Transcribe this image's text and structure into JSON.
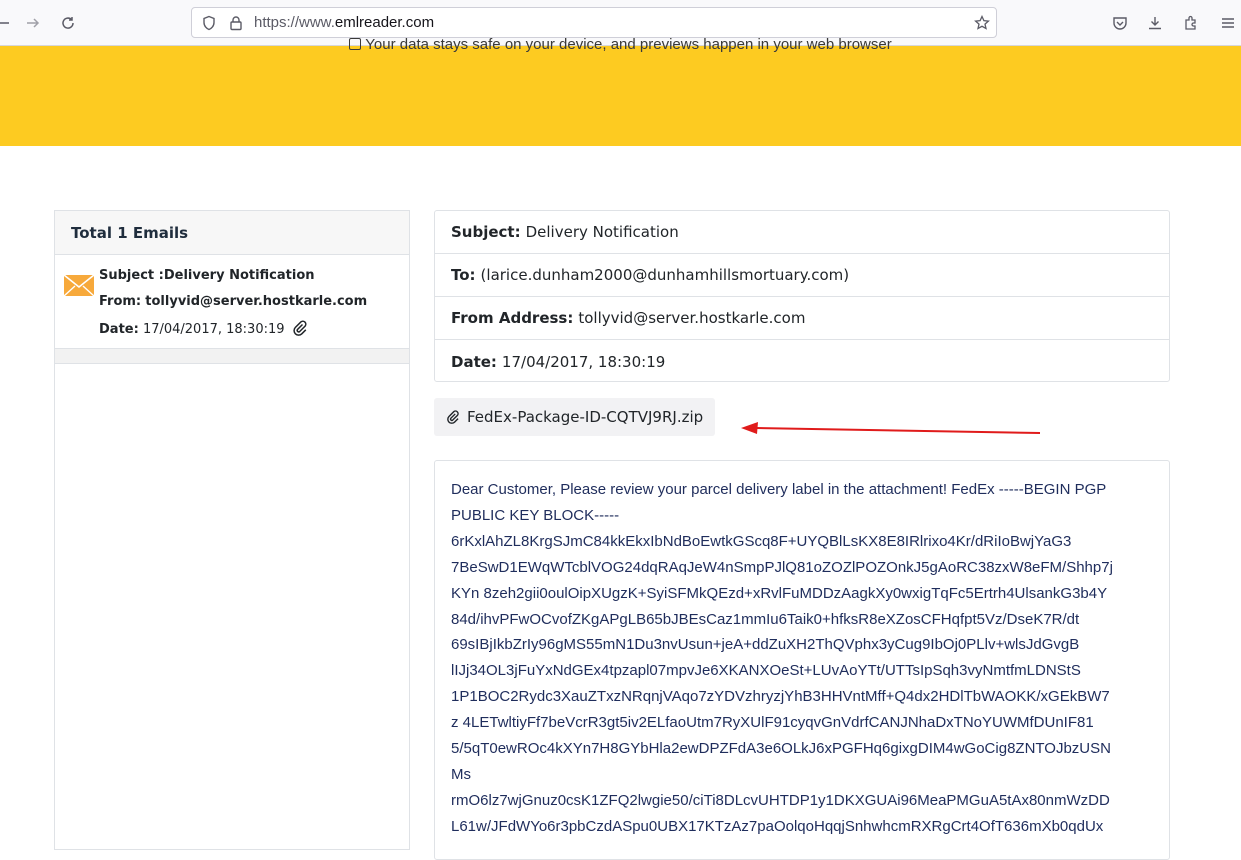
{
  "browser": {
    "url_prefix": "https://www.",
    "url_domain": "emlreader.com"
  },
  "banner": {
    "text": "Your data stays safe on your device, and previews happen in your web browser"
  },
  "list": {
    "header": "Total 1 Emails",
    "item": {
      "subject_label": "Subject :",
      "subject": "Delivery Notification",
      "from_label": "From:",
      "from": "tollyvid@server.hostkarle.com",
      "date_label": "Date:",
      "date": "17/04/2017, 18:30:19"
    }
  },
  "headers": {
    "subject_label": "Subject:",
    "subject": "Delivery Notification",
    "to_label": "To:",
    "to": "(larice.dunham2000@dunhamhillsmortuary.com)",
    "from_label": "From Address:",
    "from": "tollyvid@server.hostkarle.com",
    "date_label": "Date:",
    "date": "17/04/2017, 18:30:19"
  },
  "attachment": {
    "filename": "FedEx-Package-ID-CQTVJ9RJ.zip"
  },
  "body": {
    "lines": [
      "Dear Customer, Please review your parcel delivery label in the attachment! FedEx -----BEGIN PGP",
      "PUBLIC KEY BLOCK-----",
      "6rKxlAhZL8KrgSJmC84kkEkxIbNdBoEwtkGScq8F+UYQBlLsKX8E8IRlrixo4Kr/dRiIoBwjYaG3",
      "7BeSwD1EWqWTcblVOG24dqRAqJeW4nSmpPJlQ81oZOZlPOZOnkJ5gAoRC38zxW8eFM/Shhp7j",
      "KYn 8zeh2gii0oulOipXUgzK+SyiSFMkQEzd+xRvlFuMDDzAagkXy0wxigTqFc5Ertrh4UlsankG3b4Y",
      "84d/ihvPFwOCvofZKgAPgLB65bJBEsCaz1mmIu6Taik0+hfksR8eXZosCFHqfpt5Vz/DseK7R/dt",
      "69sIBjIkbZrIy96gMS55mN1Du3nvUsun+jeA+ddZuXH2ThQVphx3yCug9IbOj0PLlv+wlsJdGvgB",
      "lIJj34OL3jFuYxNdGEx4tpzapl07mpvJe6XKANXOeSt+LUvAoYTt/UTTsIpSqh3vyNmtfmLDNStS",
      "1P1BOC2Rydc3XauZTxzNRqnjVAqo7zYDVzhryzjYhB3HHVntMff+Q4dx2HDlTbWAOKK/xGEkBW7",
      "z 4LETwltiyFf7beVcrR3gt5iv2ELfaoUtm7RyXUlF91cyqvGnVdrfCANJNhaDxTNoYUWMfDUnIF81",
      "5/5qT0ewROc4kXYn7H8GYbHla2ewDPZFdA3e6OLkJ6xPGFHq6gixgDIM4wGoCig8ZNTOJbzUSN",
      "Ms",
      "rmO6lz7wjGnuz0csK1ZFQ2lwgie50/ciTi8DLcvUHTDP1y1DKXGUAi96MeaPMGuA5tAx80nmWzDD",
      "L61w/JFdWYo6r3pbCzdASpu0UBX17KTzAz7paOolqoHqqjSnhwhcmRXRgCrt4OfT636mXb0qdUx"
    ]
  },
  "colors": {
    "banner": "#fdcb21",
    "annotation_arrow": "#e01b1b",
    "body_text": "#1f2d5c"
  }
}
